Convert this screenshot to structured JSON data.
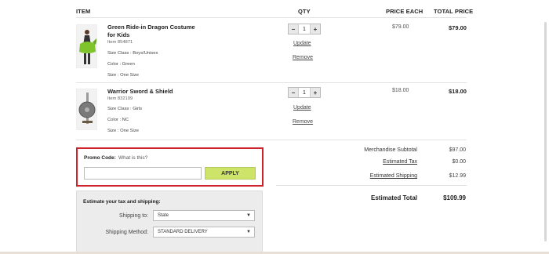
{
  "columns": {
    "item": "ITEM",
    "qty": "QTY",
    "price_each": "PRICE EACH",
    "total_price": "TOTAL PRICE"
  },
  "items": [
    {
      "name_line1": "Green Ride-in Dragon Costume",
      "name_line2": "for Kids",
      "item_no": "Item 854871",
      "size_class": "Size Class : Boys/Unisex",
      "color": "Color : Green",
      "size": "Size : One Size",
      "quantity": "1",
      "update": "Update",
      "remove": "Remove",
      "price_each": "$79.00",
      "total": "$79.00"
    },
    {
      "name_line1": "Warrior Sword & Shield",
      "item_no": "Item 832109",
      "size_class": "Size Class : Girls",
      "color": "Color : NC",
      "size": "Size : One Size",
      "quantity": "1",
      "update": "Update",
      "remove": "Remove",
      "price_each": "$18.00",
      "total": "$18.00"
    }
  ],
  "qty_controls": {
    "minus": "−",
    "plus": "+"
  },
  "promo": {
    "label": "Promo Code:",
    "what": "What is this?",
    "input_value": "",
    "apply": "APPLY"
  },
  "estimate": {
    "title": "Estimate your tax and shipping:",
    "shipping_to_label": "Shipping to:",
    "shipping_to_value": "State",
    "method_label": "Shipping Method:",
    "method_value": "STANDARD DELIVERY"
  },
  "summary": {
    "subtotal_label": "Merchandise Subtotal",
    "subtotal_value": "$97.00",
    "tax_label": "Estimated Tax",
    "tax_value": "$0.00",
    "shipping_label": "Estimated Shipping",
    "shipping_value": "$12.99",
    "total_label": "Estimated Total",
    "total_value": "$109.99"
  },
  "colors": {
    "apply_button": "#cde36a",
    "promo_highlight": "#d0222a"
  }
}
